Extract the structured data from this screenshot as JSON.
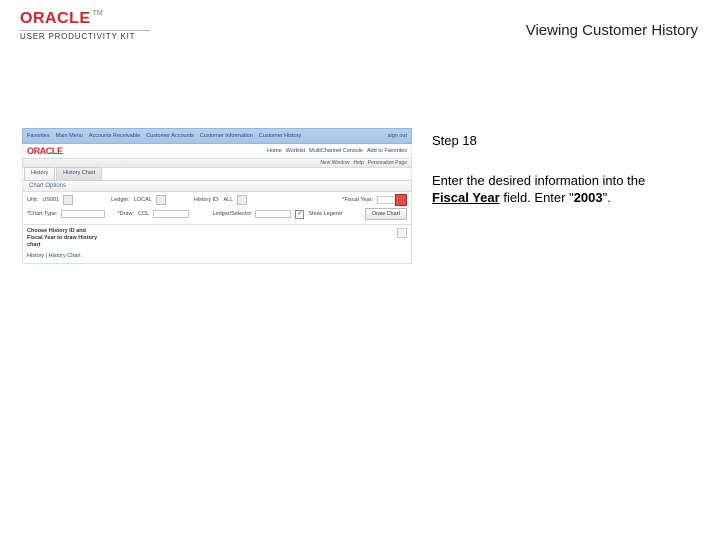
{
  "header": {
    "brand": "ORACLE",
    "tm": "TM",
    "product": "USER PRODUCTIVITY KIT",
    "page_title": "Viewing Customer History"
  },
  "instructions": {
    "step_label": "Step 18",
    "line1_pre": "Enter the desired information into the ",
    "line1_field": "Fiscal Year",
    "line1_post": " field. Enter \"",
    "line1_value": "2003",
    "line1_end": "\"."
  },
  "app": {
    "topnav": {
      "items": [
        "Favorites",
        "Main Menu",
        "Accounts Receivable",
        "Customer Accounts",
        "Customer Information",
        "Customer History"
      ],
      "right": "sign out"
    },
    "brandrow": {
      "logo": "ORACLE",
      "links": [
        "Home",
        "Worklist",
        "MultiChannel Console",
        "Add to Favorites"
      ]
    },
    "toolstrip": {
      "items": [
        "New Window",
        "Help",
        "Personalize Page"
      ]
    },
    "tabs": {
      "active": "History",
      "inactive": "History Chart"
    },
    "section_title": "Chart Options",
    "form": {
      "unit_label": "Unit:",
      "unit_value": "US001",
      "type_label": "*Chart Type:",
      "ledger_label": "Ledger:",
      "ledger_value": "LOCAL",
      "history_label": "History ID:",
      "history_value": "ALL",
      "draw_label": "*Draw:",
      "draw_value": "COL",
      "year_label": "*Fiscal Year:",
      "legend_label": "Ledger/Selector",
      "show_legend": "Show Legend",
      "button": "Draw Chart"
    },
    "results": {
      "line1": "Choose History ID and",
      "line2": "Fiscal Year to draw History",
      "line3": "chart",
      "link": "History | History Chart"
    }
  }
}
